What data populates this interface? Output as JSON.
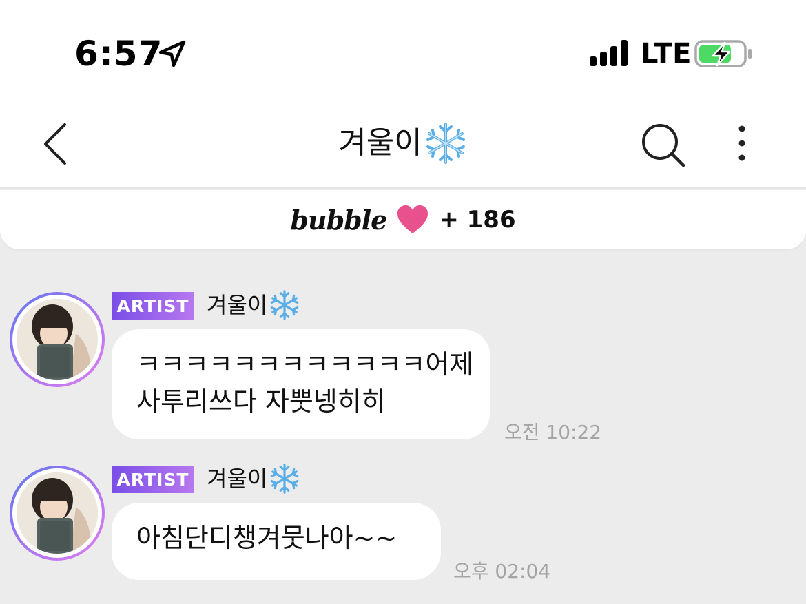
{
  "status_bar": {
    "time": "6:57",
    "network": "LTE",
    "icons": [
      "location-arrow-icon",
      "signal-bars-icon",
      "battery-charging-icon"
    ],
    "battery_color": "#4cd964"
  },
  "header": {
    "title": "겨울이",
    "title_emoji": "snowflake-icon",
    "icons": [
      "back-chevron-icon",
      "search-icon",
      "more-vertical-icon"
    ]
  },
  "banner": {
    "brand": "bubble",
    "heart_color": "#e8508e",
    "count": "+ 186"
  },
  "messages": [
    {
      "badge": "ARTIST",
      "sender": "겨울이",
      "lines": [
        "ㅋㅋㅋㅋㅋㅋㅋㅋㅋㅋㅋㅋ어제",
        "사투리쓰다 자뿟넹히히"
      ],
      "time": "오전 10:22"
    },
    {
      "badge": "ARTIST",
      "sender": "겨울이",
      "lines": [
        "아침단디챙겨뭇나아~~"
      ],
      "time": "오후 02:04"
    }
  ],
  "colors": {
    "background": "#ececec",
    "badge_start": "#7a4ee8",
    "badge_end": "#b878ef",
    "avatar_ring": "#a774f0",
    "timestamp": "#a4a4a4"
  }
}
